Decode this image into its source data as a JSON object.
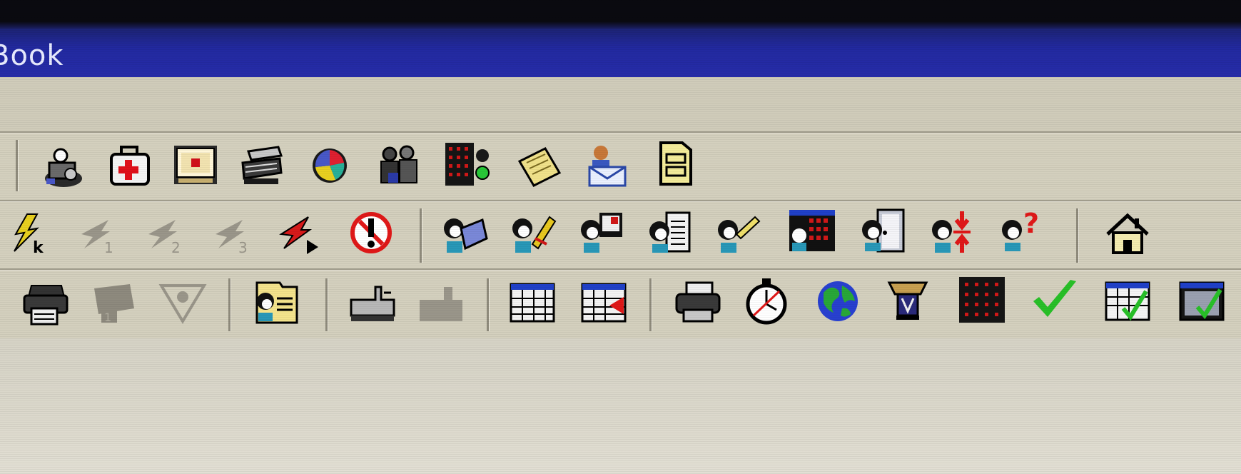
{
  "window": {
    "title": "Book"
  },
  "colors": {
    "titlebar": "#2229a0",
    "toolbar_bg": "#d4d0be"
  },
  "toolbars": [
    {
      "name": "toolbar-1",
      "items": [
        "person-money-icon",
        "first-aid-kit-icon",
        "calendar-icon",
        "cash-drawer-icon",
        "pie-chart-icon",
        "people-group-icon",
        "dot-matrix-display-icon",
        "notepad-icon",
        "user-mail-icon",
        "document-file-icon"
      ]
    },
    {
      "name": "toolbar-2",
      "items": [
        "lightning-k-icon",
        "lightning-1-icon",
        "lightning-2-icon",
        "lightning-3-icon",
        "lightning-arrow-icon",
        "stop-alert-icon",
        "person-book-icon",
        "person-edit-icon",
        "person-screen-icon",
        "person-document-icon",
        "person-pen-icon",
        "person-calendar-icon",
        "person-door-icon",
        "person-split-icon",
        "person-help-icon",
        "home-icon"
      ]
    },
    {
      "name": "toolbar-3",
      "items": [
        "printer-icon",
        "folder-disabled-icon",
        "filter-disabled-icon",
        "person-folder-icon",
        "in-tray-icon",
        "in-tray-disabled-icon",
        "table-grid-icon",
        "table-arrow-icon",
        "printer-2-icon",
        "stopwatch-icon",
        "globe-icon",
        "trophy-icon",
        "dot-grid-icon",
        "checkmark-icon",
        "table-check-icon",
        "table-check-2-icon"
      ]
    }
  ]
}
